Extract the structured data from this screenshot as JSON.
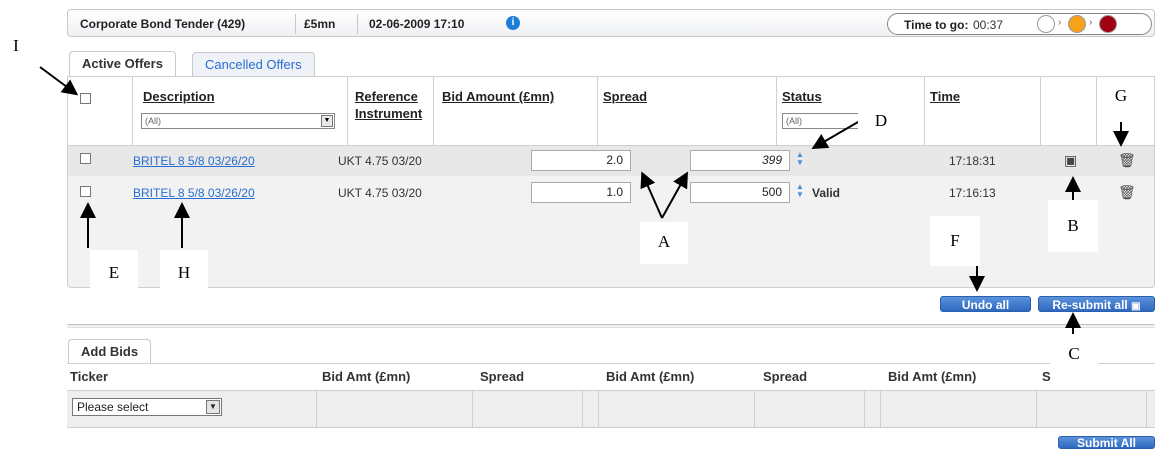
{
  "header": {
    "title": "Corporate Bond Tender (429)",
    "amount": "£5mn",
    "datetime": "02-06-2009 17:10",
    "info_icon": "i",
    "time_to_go_label": "Time to go:",
    "time_to_go_value": "00:37",
    "lights": [
      "#ffffff",
      "#f7a01b",
      "#a00010"
    ]
  },
  "tabs": {
    "active": "Active Offers",
    "cancelled": "Cancelled Offers"
  },
  "offers": {
    "columns": {
      "description": "Description",
      "reference_1": "Reference",
      "reference_2": "Instrument",
      "bid_amount": "Bid Amount (£mn)",
      "spread": "Spread",
      "status": "Status",
      "time": "Time"
    },
    "filters": {
      "description": "(All)",
      "status": "(All)"
    },
    "rows": [
      {
        "description": "BRITEL 8 5/8 03/26/20",
        "reference": "UKT 4.75 03/20",
        "bid_amount": "2.0",
        "spread": "399",
        "status": "",
        "time": "17:18:31"
      },
      {
        "description": "BRITEL 8 5/8 03/26/20",
        "reference": "UKT 4.75 03/20",
        "bid_amount": "1.0",
        "spread": "500",
        "status": "Valid",
        "time": "17:16:13"
      }
    ],
    "undo_all": "Undo all",
    "resubmit_all": "Re-submit all"
  },
  "add_bids": {
    "tab": "Add Bids",
    "columns": [
      "Ticker",
      "Bid Amt (£mn)",
      "Spread",
      "Bid Amt (£mn)",
      "Spread",
      "Bid Amt (£mn)",
      "S"
    ],
    "ticker_placeholder": "Please select",
    "submit_all": "Submit All"
  },
  "annotations": {
    "A": "A",
    "B": "B",
    "C": "C",
    "D": "D",
    "E": "E",
    "F": "F",
    "G": "G",
    "H": "H",
    "I": "I"
  }
}
